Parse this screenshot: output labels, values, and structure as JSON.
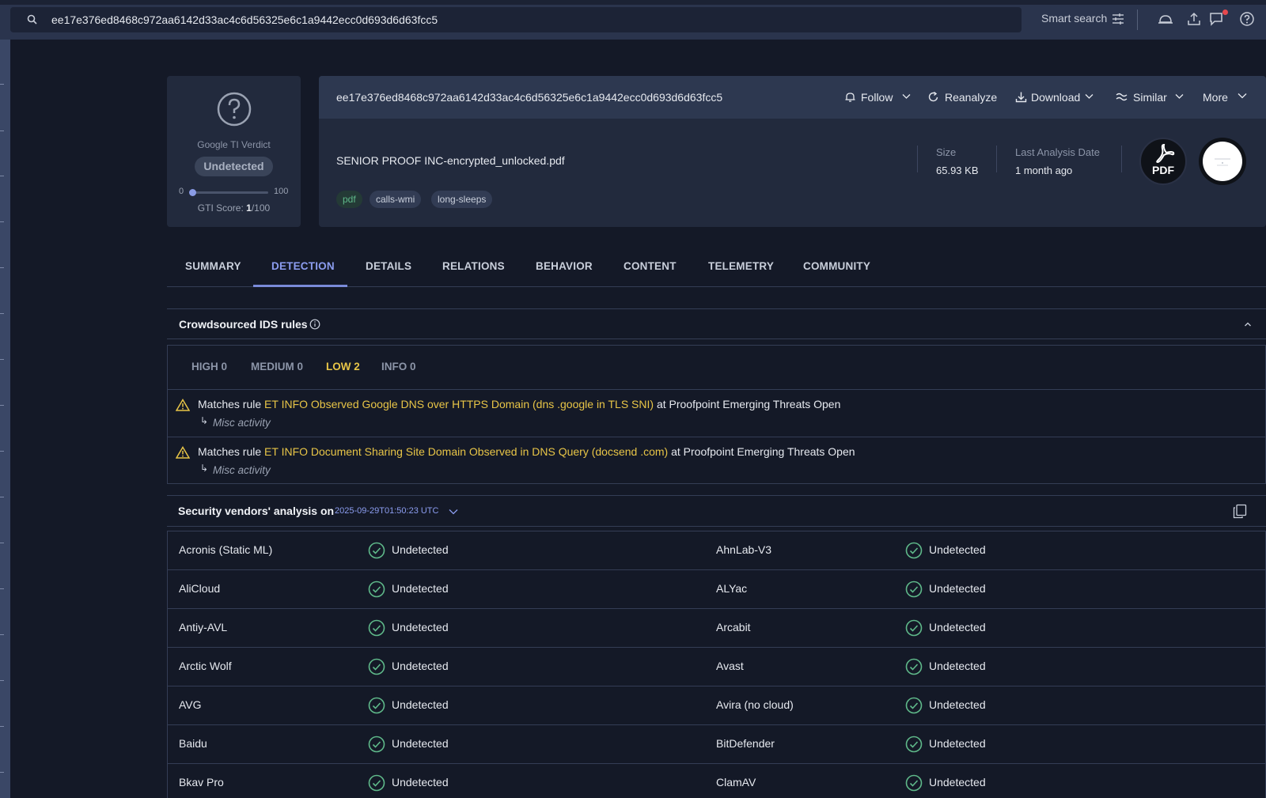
{
  "search": {
    "query": "ee17e376ed8468c972aa6142d33ac4c6d56325e6c1a9442ecc0d693d6d63fcc5"
  },
  "topbar": {
    "smart_search": "Smart search"
  },
  "verdict": {
    "label": "Google TI Verdict",
    "value": "Undetected",
    "scale_min": "0",
    "scale_max": "100",
    "score_label": "GTI Score:",
    "score_value": "1",
    "score_total": "/100",
    "score_fraction": 0.01
  },
  "file": {
    "hash": "ee17e376ed8468c972aa6142d33ac4c6d56325e6c1a9442ecc0d693d6d63fcc5",
    "name": "SENIOR PROOF INC-encrypted_unlocked.pdf",
    "tags": [
      "pdf",
      "calls-wmi",
      "long-sleeps"
    ],
    "size_label": "Size",
    "size_value": "65.93 KB",
    "date_label": "Last Analysis Date",
    "date_value": "1 month ago",
    "type_badge": "PDF"
  },
  "actions": {
    "follow": "Follow",
    "reanalyze": "Reanalyze",
    "download": "Download",
    "similar": "Similar",
    "more": "More"
  },
  "tabs": [
    "SUMMARY",
    "DETECTION",
    "DETAILS",
    "RELATIONS",
    "BEHAVIOR",
    "CONTENT",
    "TELEMETRY",
    "COMMUNITY"
  ],
  "active_tab": "DETECTION",
  "ids": {
    "title": "Crowdsourced IDS rules",
    "severities": [
      "HIGH 0",
      "MEDIUM 0",
      "LOW 2",
      "INFO 0"
    ],
    "active_severity": "LOW 2",
    "rules": [
      {
        "prefix": "Matches rule ",
        "rule": "ET INFO Observed Google DNS over HTTPS Domain (dns .google in TLS SNI)",
        "suffix": " at Proofpoint Emerging Threats Open",
        "category": "Misc activity"
      },
      {
        "prefix": "Matches rule ",
        "rule": "ET INFO Document Sharing Site Domain Observed in DNS Query (docsend .com)",
        "suffix": " at Proofpoint Emerging Threats Open",
        "category": "Misc activity"
      }
    ]
  },
  "vendors": {
    "title": "Security vendors' analysis on",
    "date": "2025-09-29T01:50:23 UTC",
    "rows": [
      {
        "left": "Acronis (Static ML)",
        "left_status": "Undetected",
        "right": "AhnLab-V3",
        "right_status": "Undetected"
      },
      {
        "left": "AliCloud",
        "left_status": "Undetected",
        "right": "ALYac",
        "right_status": "Undetected"
      },
      {
        "left": "Antiy-AVL",
        "left_status": "Undetected",
        "right": "Arcabit",
        "right_status": "Undetected"
      },
      {
        "left": "Arctic Wolf",
        "left_status": "Undetected",
        "right": "Avast",
        "right_status": "Undetected"
      },
      {
        "left": "AVG",
        "left_status": "Undetected",
        "right": "Avira (no cloud)",
        "right_status": "Undetected"
      },
      {
        "left": "Baidu",
        "left_status": "Undetected",
        "right": "BitDefender",
        "right_status": "Undetected"
      },
      {
        "left": "Bkav Pro",
        "left_status": "Undetected",
        "right": "ClamAV",
        "right_status": "Undetected"
      }
    ]
  },
  "colors": {
    "accent": "#7a8bd9",
    "warning": "#e8c547",
    "ok": "#5fb98a",
    "background": "#141927"
  }
}
